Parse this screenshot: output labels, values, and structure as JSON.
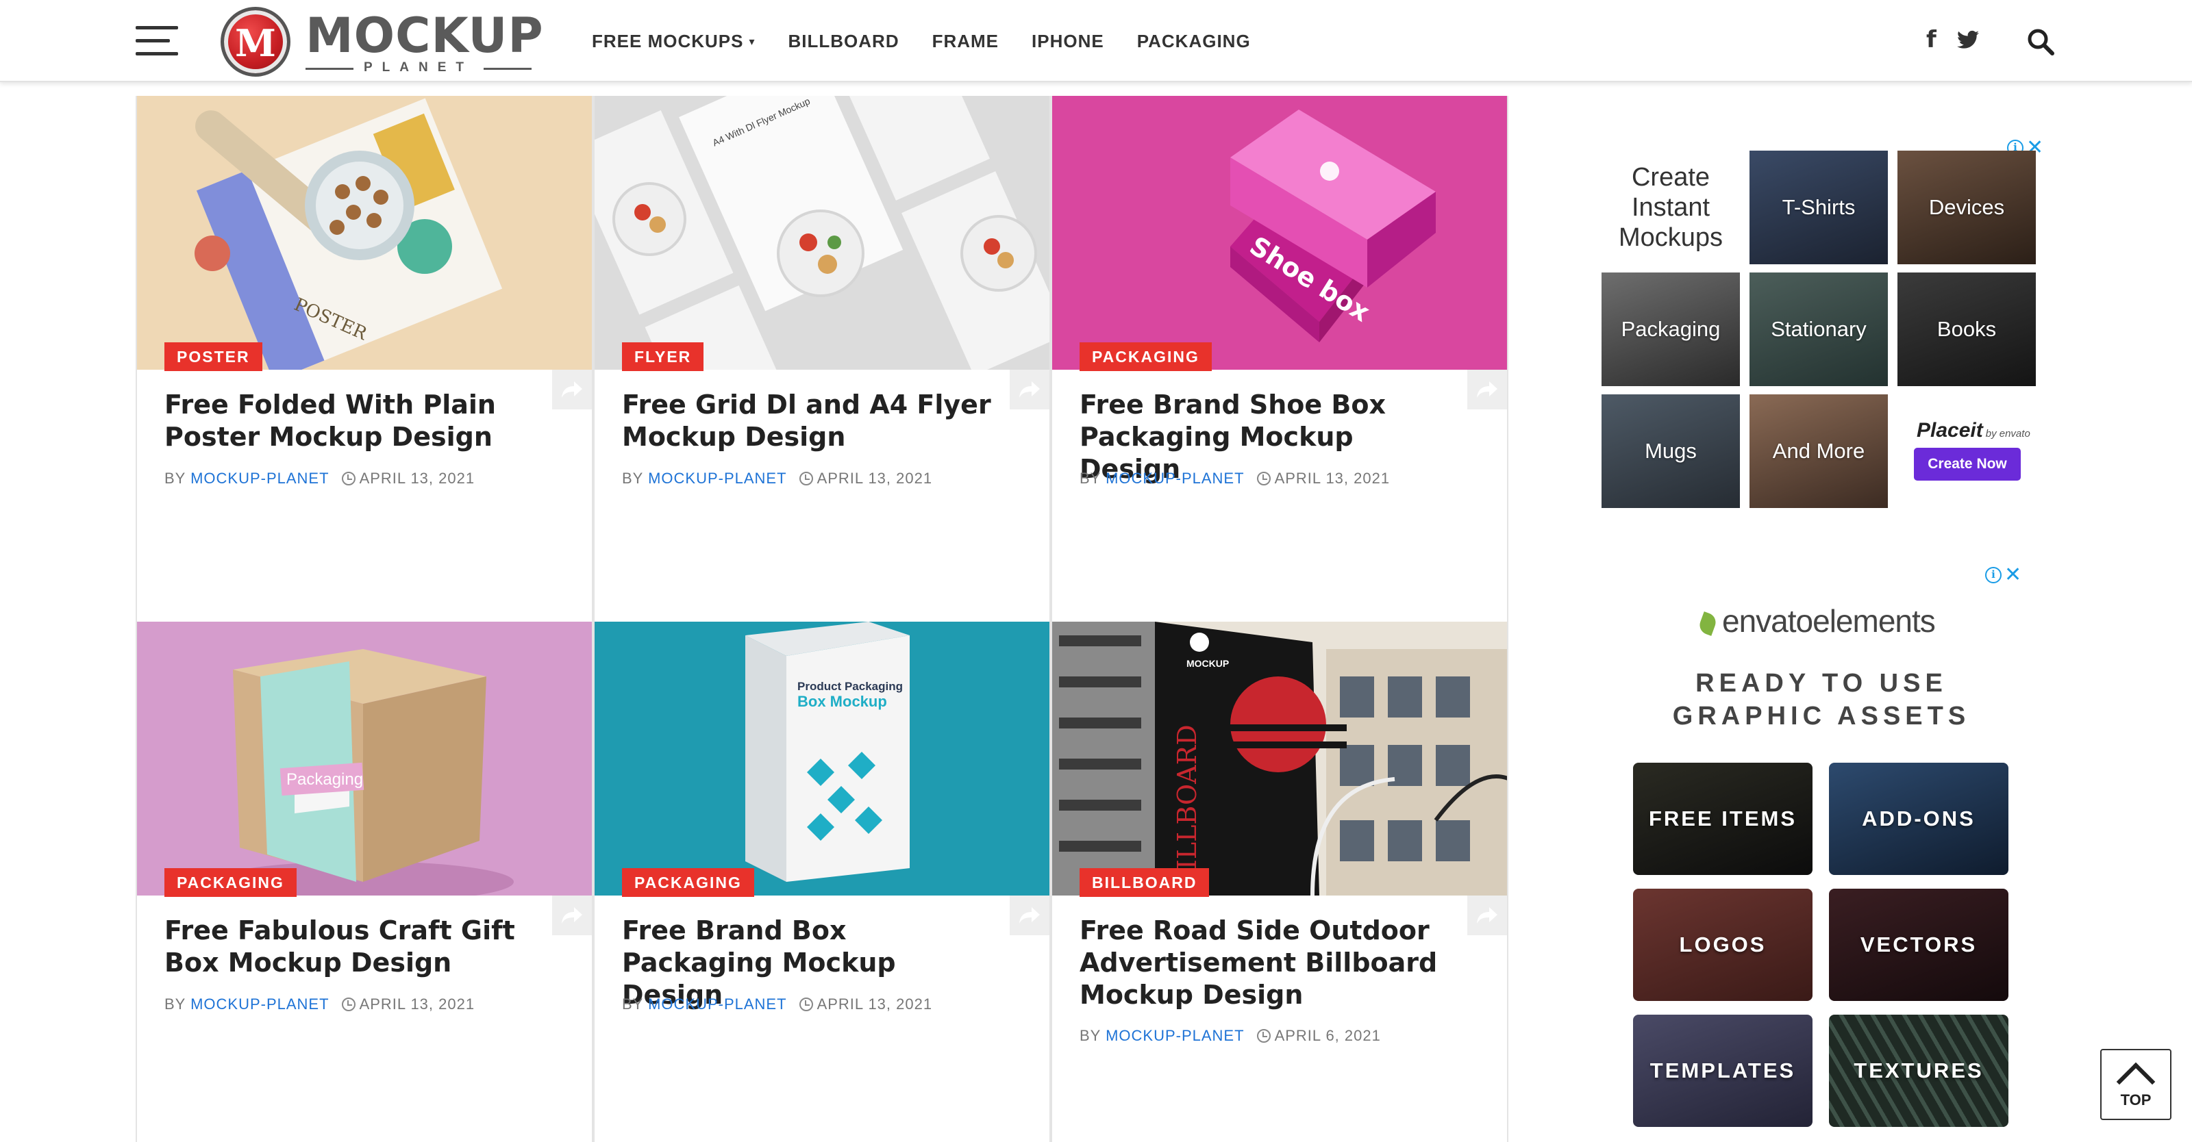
{
  "header": {
    "logo_text": "MOCKUP",
    "logo_sub": "PLANET",
    "logo_badge_letter": "M",
    "nav": [
      {
        "label": "FREE MOCKUPS",
        "dropdown": true
      },
      {
        "label": "BILLBOARD"
      },
      {
        "label": "FRAME"
      },
      {
        "label": "IPHONE"
      },
      {
        "label": "PACKAGING"
      }
    ],
    "social_facebook_glyph": "f"
  },
  "posts": [
    {
      "category": "POSTER",
      "title": "Free Folded With Plain Poster Mockup Design",
      "by": "BY",
      "author": "MOCKUP-PLANET",
      "date": "APRIL 13, 2021"
    },
    {
      "category": "FLYER",
      "title": "Free Grid Dl and A4 Flyer Mockup Design",
      "by": "BY",
      "author": "MOCKUP-PLANET",
      "date": "APRIL 13, 2021"
    },
    {
      "category": "PACKAGING",
      "title": "Free Brand Shoe Box Packaging Mockup Design",
      "by": "BY",
      "author": "MOCKUP-PLANET",
      "date": "APRIL 13, 2021"
    },
    {
      "category": "PACKAGING",
      "title": "Free Fabulous Craft Gift Box Mockup Design",
      "by": "BY",
      "author": "MOCKUP-PLANET",
      "date": "APRIL 13, 2021"
    },
    {
      "category": "PACKAGING",
      "title": "Free Brand Box Packaging Mockup Design",
      "by": "BY",
      "author": "MOCKUP-PLANET",
      "date": "APRIL 13, 2021"
    },
    {
      "category": "BILLBOARD",
      "title": "Free Road Side Outdoor Advertisement Billboard Mockup Design",
      "by": "BY",
      "author": "MOCKUP-PLANET",
      "date": "APRIL 6, 2021"
    }
  ],
  "thumb_text": {
    "poster": "POSTER",
    "shoebox": "Shoe box",
    "craft": "Packaging",
    "boxpack_line1": "Product Packaging",
    "boxpack_line2": "Box Mockup",
    "billboard": "BILLBOARD",
    "billboard_brand": "MOCKUP",
    "flyer_header": "A4 With Dl Flyer Mockup"
  },
  "ad_placeit": {
    "headline": "Create Instant Mockups",
    "tiles": [
      "T-Shirts",
      "Devices",
      "Packaging",
      "Stationary",
      "Books",
      "Mugs",
      "And More"
    ],
    "brand": "Placeit",
    "brand_by": "by envato",
    "cta": "Create Now"
  },
  "ad_envato": {
    "logo": "envatoelements",
    "tagline_1": "READY TO USE",
    "tagline_2": "GRAPHIC ASSETS",
    "buttons": [
      "FREE ITEMS",
      "ADD-ONS",
      "LOGOS",
      "VECTORS",
      "TEMPLATES",
      "TEXTURES"
    ]
  },
  "to_top_label": "TOP",
  "colors": {
    "category_badge": "#e8322b",
    "author_link": "#1e73d6",
    "placeit_cta": "#6b2bd9",
    "envato_leaf": "#82b440",
    "ad_info": "#1a9ce6"
  }
}
